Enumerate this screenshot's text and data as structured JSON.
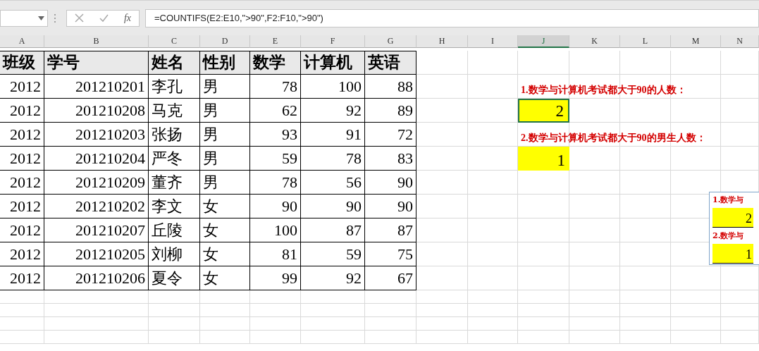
{
  "formula_bar": {
    "fx": "fx",
    "formula": "=COUNTIFS(E2:E10,\">90\",F2:F10,\">90\")"
  },
  "columns": [
    {
      "label": "A",
      "selected": false
    },
    {
      "label": "B",
      "selected": false
    },
    {
      "label": "C",
      "selected": false
    },
    {
      "label": "D",
      "selected": false
    },
    {
      "label": "E",
      "selected": false
    },
    {
      "label": "F",
      "selected": false
    },
    {
      "label": "G",
      "selected": false
    },
    {
      "label": "H",
      "selected": false
    },
    {
      "label": "I",
      "selected": false
    },
    {
      "label": "J",
      "selected": true
    },
    {
      "label": "K",
      "selected": false
    },
    {
      "label": "L",
      "selected": false
    },
    {
      "label": "M",
      "selected": false
    },
    {
      "label": "N",
      "selected": false
    }
  ],
  "table": {
    "header": [
      "班级",
      "学号",
      "姓名",
      "性别",
      "数学",
      "计算机",
      "英语"
    ],
    "rows": [
      [
        "2012",
        "201210201",
        "李孔",
        "男",
        "78",
        "100",
        "88"
      ],
      [
        "2012",
        "201210208",
        "马克",
        "男",
        "62",
        "92",
        "89"
      ],
      [
        "2012",
        "201210203",
        "张扬",
        "男",
        "93",
        "91",
        "72"
      ],
      [
        "2012",
        "201210204",
        "严冬",
        "男",
        "59",
        "78",
        "83"
      ],
      [
        "2012",
        "201210209",
        "董齐",
        "男",
        "78",
        "56",
        "90"
      ],
      [
        "2012",
        "201210202",
        "李文",
        "女",
        "90",
        "90",
        "90"
      ],
      [
        "2012",
        "201210207",
        "丘陵",
        "女",
        "100",
        "87",
        "87"
      ],
      [
        "2012",
        "201210205",
        "刘柳",
        "女",
        "81",
        "59",
        "75"
      ],
      [
        "2012",
        "201210206",
        "夏令",
        "女",
        "99",
        "92",
        "67"
      ]
    ]
  },
  "summary": [
    {
      "label": "1.数学与计算机考试都大于90的人数：",
      "value": "2",
      "selected": true
    },
    {
      "label": "2.数学与计算机考试都大于90的男生人数：",
      "value": "1",
      "selected": false
    }
  ],
  "floating_copy": [
    {
      "label": "1.数学与",
      "value": "2"
    },
    {
      "label": "2.数学与",
      "value": "1"
    }
  ]
}
